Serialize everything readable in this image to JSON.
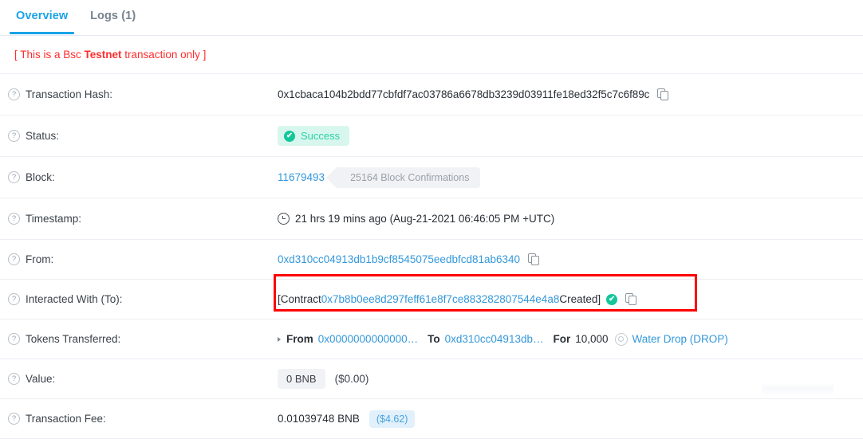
{
  "tabs": [
    {
      "label": "Overview",
      "active": true
    },
    {
      "label": "Logs (1)",
      "active": false
    }
  ],
  "banner": {
    "prefix": "[ This is a Bsc ",
    "emphasis": "Testnet",
    "suffix": " transaction only ]",
    "color": "#ff2d2d"
  },
  "rows": {
    "transaction_hash": {
      "label": "Transaction Hash:",
      "value": "0x1cbaca104b2bdd77cbfdf7ac03786a6678db3239d03911fe18ed32f5c7c6f89c",
      "copy_icon": "copy-icon"
    },
    "status": {
      "label": "Status:",
      "badge": "Success",
      "badge_bg": "#d7f7ee",
      "badge_color": "#2dd0a5"
    },
    "block": {
      "label": "Block:",
      "number": "11679493",
      "confirmations": "25164 Block Confirmations"
    },
    "timestamp": {
      "label": "Timestamp:",
      "value": "21 hrs 19 mins ago (Aug-21-2021 06:46:05 PM +UTC)"
    },
    "from": {
      "label": "From:",
      "address": "0xd310cc04913db1b9cf8545075eedbfcd81ab6340"
    },
    "interacted_with": {
      "label": "Interacted With (To):",
      "prefix": "[Contract ",
      "address": "0x7b8b0ee8d297feff61e8f7ce883282807544e4a8",
      "suffix": " Created]",
      "highlight_color": "#ff0000"
    },
    "tokens_transferred": {
      "label": "Tokens Transferred:",
      "from_label": "From",
      "from_address": "0x0000000000000…",
      "to_label": "To",
      "to_address": "0xd310cc04913db…",
      "for_label": "For",
      "amount": "10,000",
      "token": "Water Drop (DROP)"
    },
    "value": {
      "label": "Value:",
      "amount": "0 BNB",
      "usd": "($0.00)"
    },
    "transaction_fee": {
      "label": "Transaction Fee:",
      "amount": "0.01039748 BNB",
      "usd": "($4.62)"
    }
  },
  "icons": {
    "help": "?",
    "check": "✔"
  }
}
